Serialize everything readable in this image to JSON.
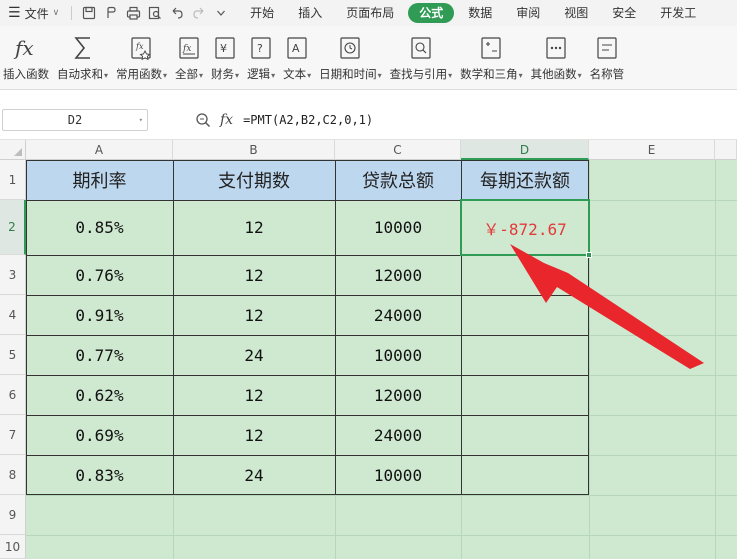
{
  "menubar": {
    "file_label": "文件",
    "tabs": [
      "开始",
      "插入",
      "页面布局",
      "公式",
      "数据",
      "审阅",
      "视图",
      "安全",
      "开发工"
    ],
    "active_tab": "公式"
  },
  "ribbon": {
    "items": [
      {
        "label": "插入函数",
        "icon": "fx-icon",
        "dropdown": false
      },
      {
        "label": "自动求和",
        "icon": "sigma-icon",
        "dropdown": true
      },
      {
        "label": "常用函数",
        "icon": "star-function-icon",
        "dropdown": true
      },
      {
        "label": "全部",
        "icon": "all-functions-icon",
        "dropdown": true
      },
      {
        "label": "财务",
        "icon": "finance-icon",
        "dropdown": true
      },
      {
        "label": "逻辑",
        "icon": "logic-icon",
        "dropdown": true
      },
      {
        "label": "文本",
        "icon": "text-icon",
        "dropdown": true
      },
      {
        "label": "日期和时间",
        "icon": "clock-icon",
        "dropdown": true
      },
      {
        "label": "查找与引用",
        "icon": "lookup-icon",
        "dropdown": true
      },
      {
        "label": "数学和三角",
        "icon": "math-icon",
        "dropdown": true
      },
      {
        "label": "其他函数",
        "icon": "more-functions-icon",
        "dropdown": true
      },
      {
        "label": "名称管",
        "icon": "name-manager-icon",
        "dropdown": false
      }
    ]
  },
  "formula_bar": {
    "name_box": "D2",
    "fx_label": "fx",
    "formula": "=PMT(A2,B2,C2,0,1)"
  },
  "sheet": {
    "columns": [
      "A",
      "B",
      "C",
      "D",
      "E"
    ],
    "selected_column": "D",
    "rows": [
      "1",
      "2",
      "3",
      "4",
      "5",
      "6",
      "7",
      "8",
      "9",
      "10"
    ],
    "selected_row": "2",
    "headers": [
      "期利率",
      "支付期数",
      "贷款总额",
      "每期还款额"
    ],
    "data": [
      [
        "0.85%",
        "12",
        "10000",
        "￥-872.67"
      ],
      [
        "0.76%",
        "12",
        "12000",
        ""
      ],
      [
        "0.91%",
        "12",
        "24000",
        ""
      ],
      [
        "0.77%",
        "24",
        "10000",
        ""
      ],
      [
        "0.62%",
        "12",
        "12000",
        ""
      ],
      [
        "0.69%",
        "12",
        "24000",
        ""
      ],
      [
        "0.83%",
        "24",
        "10000",
        ""
      ]
    ],
    "result_color": "#e23b3b",
    "header_fill": "#bdd7ee",
    "sheet_fill": "#cfe9d1",
    "accent": "#2f9b55"
  }
}
